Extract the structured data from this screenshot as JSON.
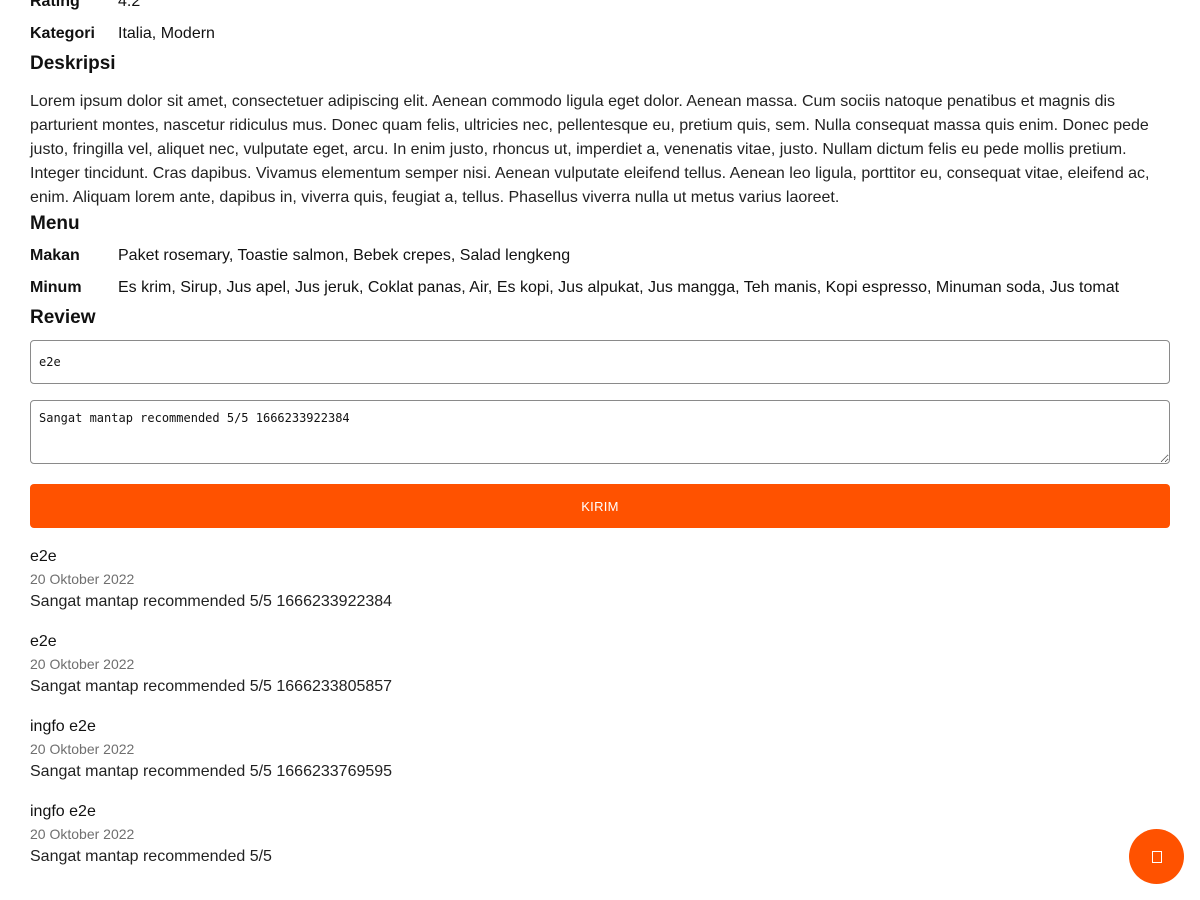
{
  "details": {
    "rating_label": "Rating",
    "rating_value": "4.2",
    "category_label": "Kategori",
    "category_value": "Italia, Modern"
  },
  "description": {
    "title": "Deskripsi",
    "text": "Lorem ipsum dolor sit amet, consectetuer adipiscing elit. Aenean commodo ligula eget dolor. Aenean massa. Cum sociis natoque penatibus et magnis dis parturient montes, nascetur ridiculus mus. Donec quam felis, ultricies nec, pellentesque eu, pretium quis, sem. Nulla consequat massa quis enim. Donec pede justo, fringilla vel, aliquet nec, vulputate eget, arcu. In enim justo, rhoncus ut, imperdiet a, venenatis vitae, justo. Nullam dictum felis eu pede mollis pretium. Integer tincidunt. Cras dapibus. Vivamus elementum semper nisi. Aenean vulputate eleifend tellus. Aenean leo ligula, porttitor eu, consequat vitae, eleifend ac, enim. Aliquam lorem ante, dapibus in, viverra quis, feugiat a, tellus. Phasellus viverra nulla ut metus varius laoreet."
  },
  "menu": {
    "title": "Menu",
    "food_label": "Makan",
    "food_value": "Paket rosemary, Toastie salmon, Bebek crepes, Salad lengkeng",
    "drink_label": "Minum",
    "drink_value": "Es krim, Sirup, Jus apel, Jus jeruk, Coklat panas, Air, Es kopi, Jus alpukat, Jus mangga, Teh manis, Kopi espresso, Minuman soda, Jus tomat"
  },
  "review_form": {
    "title": "Review",
    "name_value": "e2e",
    "review_value": "Sangat mantap recommended 5/5 1666233922384",
    "submit_label": "KIRIM"
  },
  "reviews": [
    {
      "name": "e2e",
      "date": "20 Oktober 2022",
      "text": "Sangat mantap recommended 5/5 1666233922384"
    },
    {
      "name": "e2e",
      "date": "20 Oktober 2022",
      "text": "Sangat mantap recommended 5/5 1666233805857"
    },
    {
      "name": "ingfo e2e",
      "date": "20 Oktober 2022",
      "text": "Sangat mantap recommended 5/5 1666233769595"
    },
    {
      "name": "ingfo e2e",
      "date": "20 Oktober 2022",
      "text": "Sangat mantap recommended 5/5"
    }
  ],
  "fab": {
    "icon": "chat-icon",
    "color": "#ff5200"
  },
  "colors": {
    "accent": "#ff5200",
    "date_text": "#6f6f6f"
  }
}
